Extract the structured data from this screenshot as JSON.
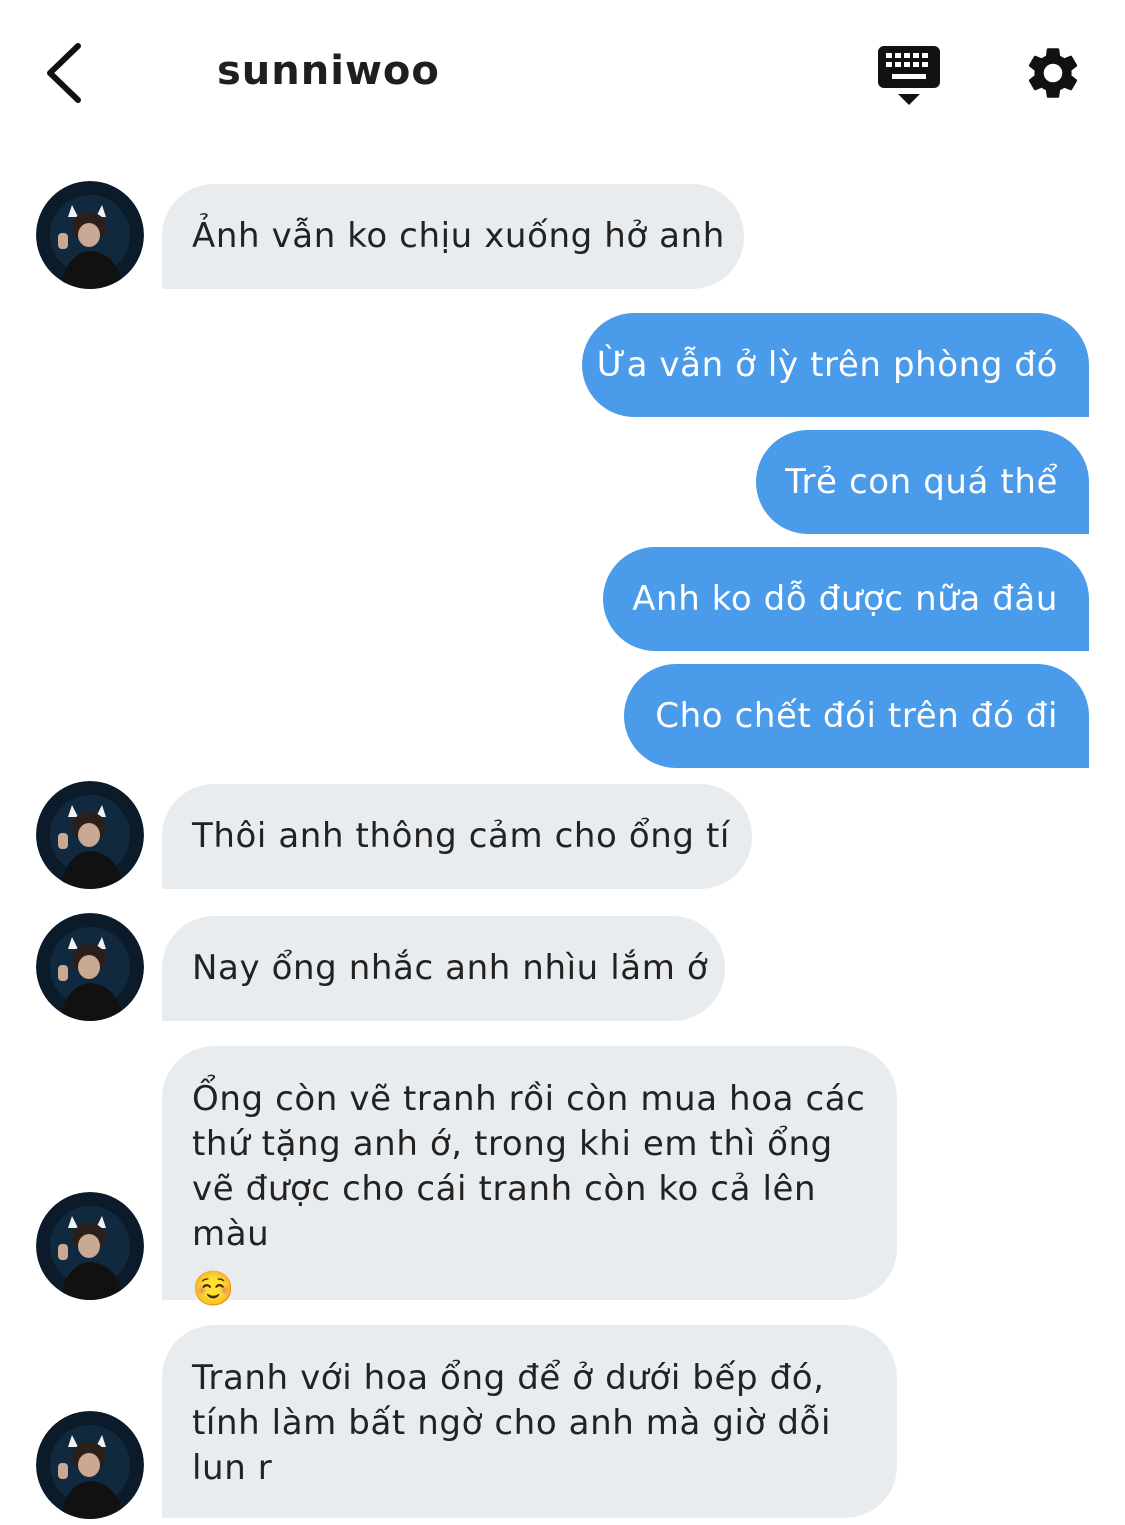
{
  "header": {
    "title": "sunniwoo",
    "back_icon": "chevron-left-icon",
    "keyboard_icon": "keyboard-icon",
    "settings_icon": "gear-icon"
  },
  "colors": {
    "incoming_bubble": "#e9ecef",
    "outgoing_bubble": "#4a9be9"
  },
  "messages": [
    {
      "direction": "incoming",
      "avatar": true,
      "text": "Ảnh vẫn ko chịu xuống hở anh"
    },
    {
      "direction": "outgoing",
      "text": "Ừa vẫn ở lỳ trên phòng đó"
    },
    {
      "direction": "outgoing",
      "text": "Trẻ con quá thể"
    },
    {
      "direction": "outgoing",
      "text": "Anh ko dỗ được nữa đâu"
    },
    {
      "direction": "outgoing",
      "text": "Cho chết đói trên đó đi"
    },
    {
      "direction": "incoming",
      "avatar": true,
      "text": "Thôi anh thông cảm cho ổng tí"
    },
    {
      "direction": "incoming",
      "avatar": true,
      "text": "Nay ổng nhắc anh nhìu lắm ớ"
    },
    {
      "direction": "incoming",
      "avatar": true,
      "text": "Ổng còn vẽ tranh rồi còn mua hoa các thứ tặng anh ớ, trong khi em thì ổng vẽ được cho cái tranh còn ko cả lên màu",
      "emoji": "☺️"
    },
    {
      "direction": "incoming",
      "avatar": true,
      "text": "Tranh với hoa ổng để ở dưới bếp đó, tính làm bất ngờ cho anh mà giờ dỗi lun r"
    }
  ]
}
